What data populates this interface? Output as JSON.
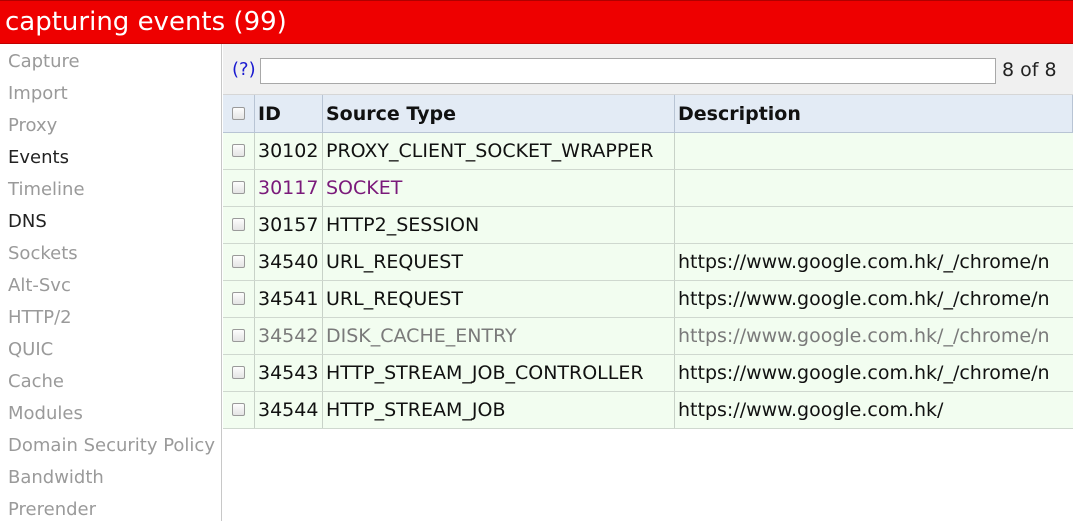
{
  "window": {
    "title": "capturing events (99)"
  },
  "sidebar": {
    "items": [
      {
        "label": "Capture",
        "dark": false
      },
      {
        "label": "Import",
        "dark": false
      },
      {
        "label": "Proxy",
        "dark": false
      },
      {
        "label": "Events",
        "dark": true
      },
      {
        "label": "Timeline",
        "dark": false
      },
      {
        "label": "DNS",
        "dark": true
      },
      {
        "label": "Sockets",
        "dark": false
      },
      {
        "label": "Alt-Svc",
        "dark": false
      },
      {
        "label": "HTTP/2",
        "dark": false
      },
      {
        "label": "QUIC",
        "dark": false
      },
      {
        "label": "Cache",
        "dark": false
      },
      {
        "label": "Modules",
        "dark": false
      },
      {
        "label": "Domain Security Policy",
        "dark": false
      },
      {
        "label": "Bandwidth",
        "dark": false
      },
      {
        "label": "Prerender",
        "dark": false
      }
    ]
  },
  "filter": {
    "help_label": "(?)",
    "value": "",
    "count_text": "8 of 8"
  },
  "table": {
    "columns": {
      "id": "ID",
      "source_type": "Source Type",
      "description": "Description"
    },
    "rows": [
      {
        "id": "30102",
        "source_type": "PROXY_CLIENT_SOCKET_WRAPPER",
        "description": "",
        "style": "normal"
      },
      {
        "id": "30117",
        "source_type": "SOCKET",
        "description": "",
        "style": "purple"
      },
      {
        "id": "30157",
        "source_type": "HTTP2_SESSION",
        "description": "",
        "style": "normal"
      },
      {
        "id": "34540",
        "source_type": "URL_REQUEST",
        "description": "https://www.google.com.hk/_/chrome/n",
        "style": "normal"
      },
      {
        "id": "34541",
        "source_type": "URL_REQUEST",
        "description": "https://www.google.com.hk/_/chrome/n",
        "style": "normal"
      },
      {
        "id": "34542",
        "source_type": "DISK_CACHE_ENTRY",
        "description": "https://www.google.com.hk/_/chrome/n",
        "style": "gray"
      },
      {
        "id": "34543",
        "source_type": "HTTP_STREAM_JOB_CONTROLLER",
        "description": "https://www.google.com.hk/_/chrome/n",
        "style": "normal"
      },
      {
        "id": "34544",
        "source_type": "HTTP_STREAM_JOB",
        "description": "https://www.google.com.hk/",
        "style": "normal"
      }
    ]
  },
  "colors": {
    "title_bar": "#ee0000",
    "row_background": "#f2fdf0",
    "header_background": "#e3ebf5",
    "inactive_source_text": "#7a1a7a",
    "dead_source_text": "#7a7a7a",
    "help_link": "#1a1ad0"
  }
}
